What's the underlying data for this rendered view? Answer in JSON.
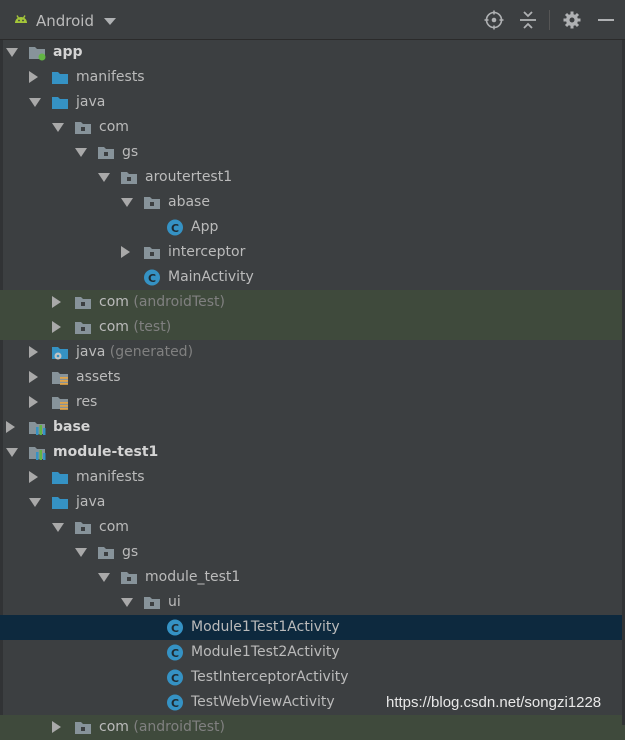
{
  "toolbar": {
    "view_title": "Android",
    "icons": [
      "target-icon",
      "collapse-icon",
      "gear-icon",
      "minimize-icon"
    ]
  },
  "tree": [
    {
      "label": "app",
      "suffix": "",
      "level": 0,
      "arrow": "down",
      "icon": "module-app",
      "bold": true
    },
    {
      "label": "manifests",
      "suffix": "",
      "level": 1,
      "arrow": "right",
      "icon": "folder-blue"
    },
    {
      "label": "java",
      "suffix": "",
      "level": 1,
      "arrow": "down",
      "icon": "folder-blue"
    },
    {
      "label": "com",
      "suffix": "",
      "level": 2,
      "arrow": "down",
      "icon": "package"
    },
    {
      "label": "gs",
      "suffix": "",
      "level": 3,
      "arrow": "down",
      "icon": "package"
    },
    {
      "label": "aroutertest1",
      "suffix": "",
      "level": 4,
      "arrow": "down",
      "icon": "package"
    },
    {
      "label": "abase",
      "suffix": "",
      "level": 5,
      "arrow": "down",
      "icon": "package"
    },
    {
      "label": "App",
      "suffix": "",
      "level": 6,
      "arrow": "none",
      "icon": "class"
    },
    {
      "label": "interceptor",
      "suffix": "",
      "level": 5,
      "arrow": "right",
      "icon": "package"
    },
    {
      "label": "MainActivity",
      "suffix": "",
      "level": 5,
      "arrow": "none",
      "icon": "class"
    },
    {
      "label": "com",
      "suffix": " (androidTest)",
      "level": 2,
      "arrow": "right",
      "icon": "package",
      "tinted": true
    },
    {
      "label": "com",
      "suffix": " (test)",
      "level": 2,
      "arrow": "right",
      "icon": "package",
      "tinted": true
    },
    {
      "label": "java",
      "suffix": " (generated)",
      "level": 1,
      "arrow": "right",
      "icon": "folder-generated"
    },
    {
      "label": "assets",
      "suffix": "",
      "level": 1,
      "arrow": "right",
      "icon": "folder-res"
    },
    {
      "label": "res",
      "suffix": "",
      "level": 1,
      "arrow": "right",
      "icon": "folder-res"
    },
    {
      "label": "base",
      "suffix": "",
      "level": 0,
      "arrow": "right",
      "icon": "module-lib",
      "bold": true
    },
    {
      "label": "module-test1",
      "suffix": "",
      "level": 0,
      "arrow": "down",
      "icon": "module-lib",
      "bold": true
    },
    {
      "label": "manifests",
      "suffix": "",
      "level": 1,
      "arrow": "right",
      "icon": "folder-blue"
    },
    {
      "label": "java",
      "suffix": "",
      "level": 1,
      "arrow": "down",
      "icon": "folder-blue"
    },
    {
      "label": "com",
      "suffix": "",
      "level": 2,
      "arrow": "down",
      "icon": "package"
    },
    {
      "label": "gs",
      "suffix": "",
      "level": 3,
      "arrow": "down",
      "icon": "package"
    },
    {
      "label": "module_test1",
      "suffix": "",
      "level": 4,
      "arrow": "down",
      "icon": "package"
    },
    {
      "label": "ui",
      "suffix": "",
      "level": 5,
      "arrow": "down",
      "icon": "package"
    },
    {
      "label": "Module1Test1Activity",
      "suffix": "",
      "level": 6,
      "arrow": "none",
      "icon": "class",
      "selected": true
    },
    {
      "label": "Module1Test2Activity",
      "suffix": "",
      "level": 6,
      "arrow": "none",
      "icon": "class"
    },
    {
      "label": "TestInterceptorActivity",
      "suffix": "",
      "level": 6,
      "arrow": "none",
      "icon": "class"
    },
    {
      "label": "TestWebViewActivity",
      "suffix": "",
      "level": 6,
      "arrow": "none",
      "icon": "class"
    },
    {
      "label": "com",
      "suffix": " (androidTest)",
      "level": 2,
      "arrow": "right",
      "icon": "package",
      "tinted": true
    }
  ],
  "watermark": "https://blog.csdn.net/songzi1228",
  "colors": {
    "background": "#3c3f41",
    "selection": "#0d293e",
    "test_tint": "#3f4a3c",
    "folder_blue": "#3592c4",
    "class_icon": "#3592c4",
    "android_green": "#a4c639"
  }
}
